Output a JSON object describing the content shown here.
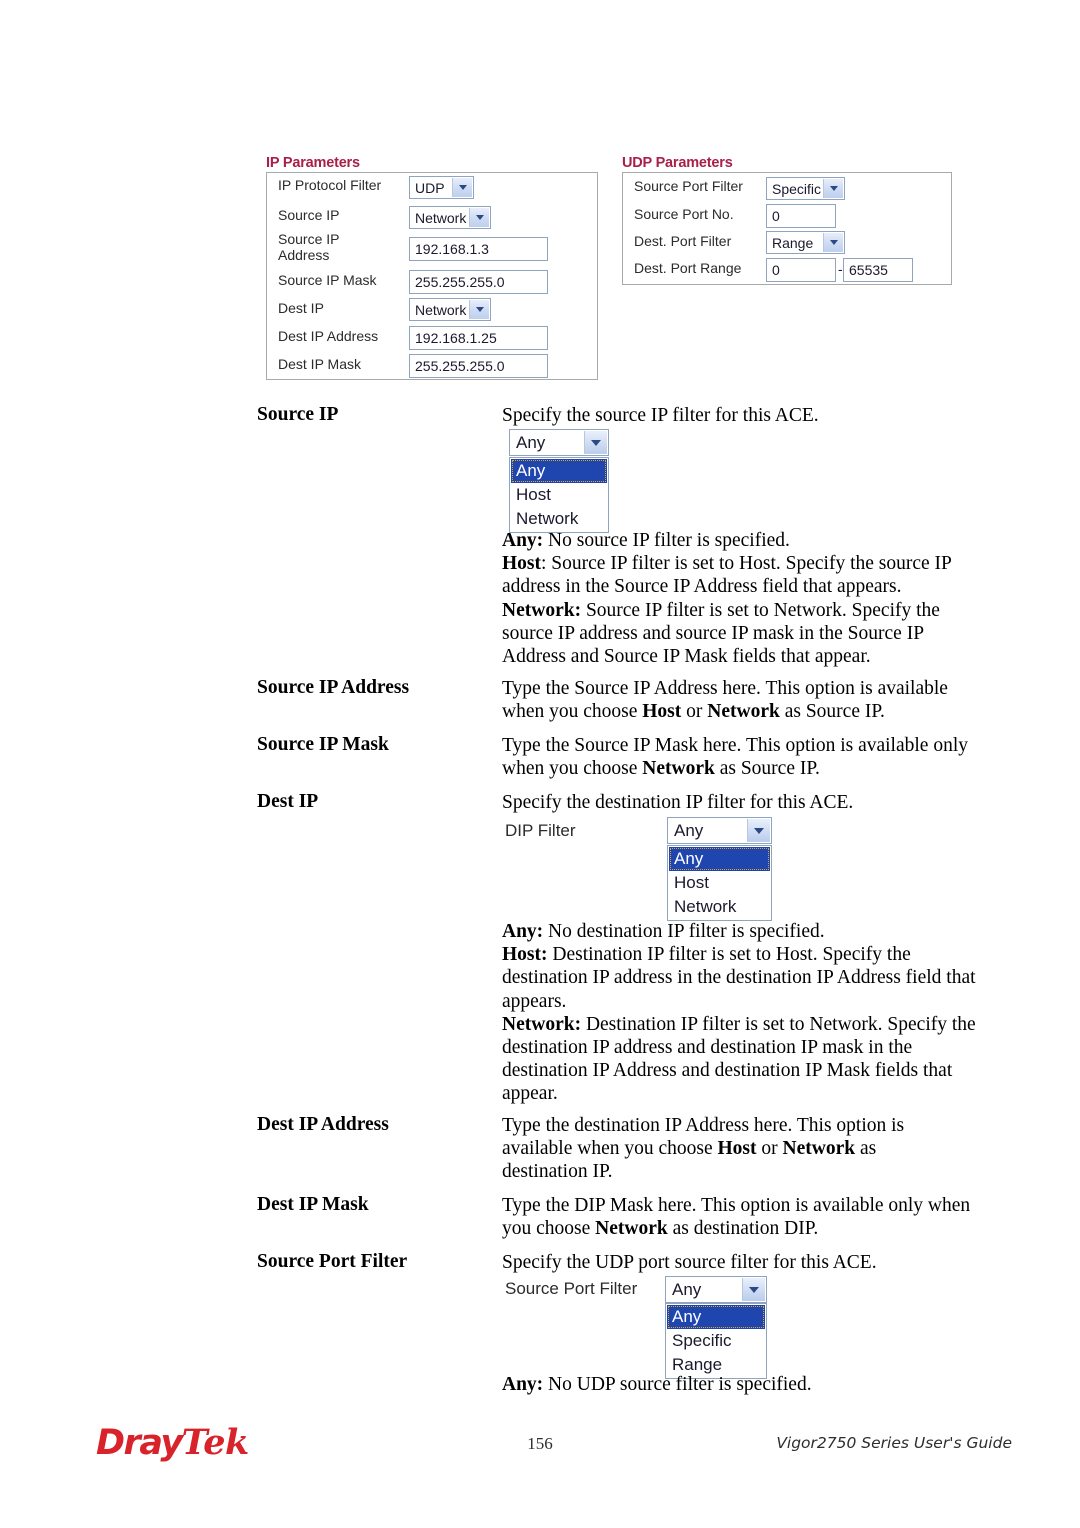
{
  "panels": {
    "ip": {
      "title": "IP Parameters",
      "rows": [
        {
          "label": "IP Protocol Filter",
          "widget": "select",
          "value": "UDP"
        },
        {
          "label": "Source IP",
          "widget": "select",
          "value": "Network"
        },
        {
          "label": "Source IP\nAddress",
          "widget": "text",
          "value": "192.168.1.3"
        },
        {
          "label": "Source IP Mask",
          "widget": "text",
          "value": "255.255.255.0"
        },
        {
          "label": "Dest IP",
          "widget": "select",
          "value": "Network"
        },
        {
          "label": "Dest IP Address",
          "widget": "text",
          "value": "192.168.1.25"
        },
        {
          "label": "Dest IP Mask",
          "widget": "text",
          "value": "255.255.255.0"
        }
      ]
    },
    "udp": {
      "title": "UDP Parameters",
      "rows": [
        {
          "label": "Source Port Filter",
          "widget": "select",
          "value": "Specific"
        },
        {
          "label": "Source Port No.",
          "widget": "text",
          "value": "0"
        },
        {
          "label": "Dest. Port Filter",
          "widget": "select",
          "value": "Range"
        },
        {
          "label": "Dest. Port Range",
          "widget": "range",
          "value": "0",
          "separator": "-",
          "value2": "65535"
        }
      ]
    }
  },
  "definitions": [
    {
      "term": "Source IP",
      "intro": "Specify the source IP filter for this ACE.",
      "widget": {
        "type": "dropdown-open",
        "label": "",
        "selected": "Any",
        "options": [
          "Any",
          "Host",
          "Network"
        ]
      },
      "paragraphs": [
        {
          "bold": "Any:",
          "text": " No source IP filter is specified."
        },
        {
          "bold": "Host",
          "text": ": Source IP filter is set to Host. Specify the source IP address in the Source IP Address field that appears."
        },
        {
          "bold": "Network:",
          "text": " Source IP filter is set to Network. Specify the source IP address and source IP mask in the Source IP Address and Source IP Mask fields that appear."
        }
      ]
    },
    {
      "term": "Source IP Address",
      "rich": "Type the Source IP Address here. This option is available when you choose <b>Host</b> or <b>Network</b> as Source IP."
    },
    {
      "term": "Source IP Mask",
      "rich": "Type the Source IP Mask here. This option is available only when you choose <b>Network</b> as Source IP."
    },
    {
      "term": "Dest IP",
      "intro": "Specify the destination IP filter for this ACE.",
      "widget": {
        "type": "dropdown-open",
        "label": "DIP Filter",
        "selected": "Any",
        "options": [
          "Any",
          "Host",
          "Network"
        ]
      },
      "paragraphs": [
        {
          "bold": "Any:",
          "text": " No destination IP filter is specified."
        },
        {
          "bold": "Host:",
          "text": " Destination IP filter is set to Host. Specify the destination IP address in the destination IP Address field that appears."
        },
        {
          "bold": "Network:",
          "text": " Destination IP filter is set to Network. Specify the destination IP address and destination IP mask in the destination IP Address and destination IP Mask fields that appear."
        }
      ]
    },
    {
      "term": "Dest IP Address",
      "rich": "Type the destination IP Address here. This option is available when you choose <b>Host</b> or <b>Network</b> as destination IP."
    },
    {
      "term": "Dest IP Mask",
      "rich": "Type the DIP Mask here. This option is available only when you choose <b>Network</b> as destination DIP."
    },
    {
      "term": "Source Port Filter",
      "intro": "Specify the UDP port source filter for this ACE.",
      "widget": {
        "type": "dropdown-open",
        "label": "Source Port Filter",
        "selected": "Any",
        "options": [
          "Any",
          "Specific",
          "Range"
        ]
      },
      "paragraphs": [
        {
          "bold": "Any:",
          "text": " No UDP source filter is specified."
        }
      ]
    }
  ],
  "footer": {
    "logo_part1": "Dray",
    "logo_part2": "Tek",
    "page_number": "156",
    "guide_title": "Vigor2750 Series User's Guide"
  },
  "colors": {
    "panel_title": "#a81f4a",
    "logo_red": "#d8232a",
    "highlight_blue": "#1f46ae",
    "field_border": "#8fa4bd"
  }
}
